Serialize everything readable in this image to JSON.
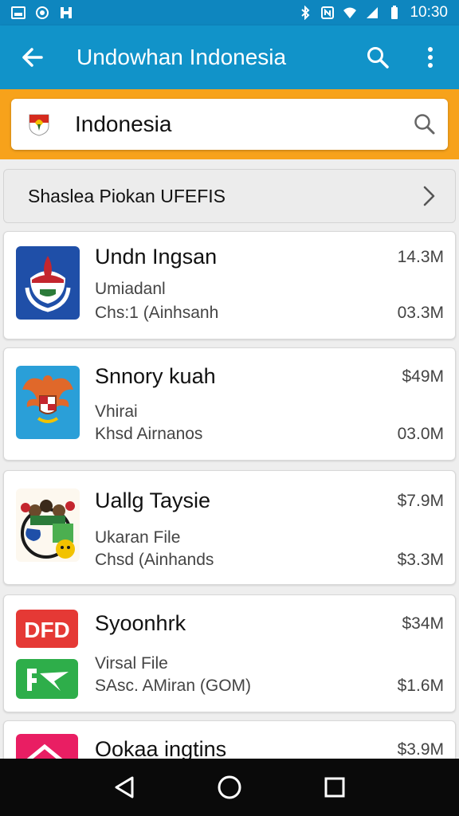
{
  "status_bar": {
    "time": "10:30"
  },
  "app_bar": {
    "title": "Undowhan Indonesia"
  },
  "search": {
    "value": "Indonesia"
  },
  "section": {
    "label": "Shaslea Piokan UFEFIS"
  },
  "items": [
    {
      "title": "Undn Ingsan",
      "sub1": "Umiadanl",
      "sub2": "Chs:1 (Ainhsanh",
      "size1": "14.3M",
      "size2": "03.3M",
      "icon": "flag-emblem-icon"
    },
    {
      "title": "Snnory kuah",
      "sub1": "Vhirai",
      "sub2": "Khsd Airnanos",
      "size1": "$49M",
      "size2": "03.0M",
      "icon": "garuda-icon"
    },
    {
      "title": "Uallg Taysie",
      "sub1": "Ukaran File",
      "sub2": "Chsd (Ainhands",
      "size1": "$7.9M",
      "size2": "$3.3M",
      "icon": "cartoon-icon"
    },
    {
      "title": "Syoonhrk",
      "sub1": "Virsal File",
      "sub2": "SAsc. AMiran (GOM)",
      "size1": "$34M",
      "size2": "$1.6M",
      "icon": "dfd-icon"
    },
    {
      "title": "Ookaa ingtins",
      "size1": "$3.9M",
      "icon": "house-icon"
    }
  ],
  "colors": {
    "status_bar": "#0e86bf",
    "app_bar": "#1193c9",
    "search_band": "#f7a21b",
    "nav_bar": "#0a0a0a"
  }
}
